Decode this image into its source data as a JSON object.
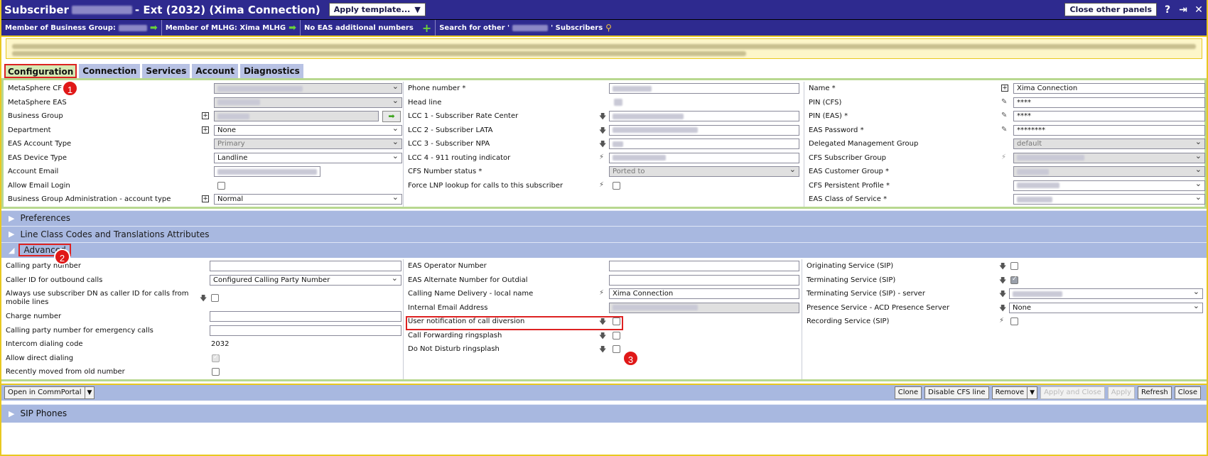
{
  "window": {
    "title_prefix": "Subscriber",
    "title_suffix": "- Ext (2032) (Xima Connection)",
    "apply_template": "Apply template...",
    "close_other_panels": "Close other panels",
    "help": "?",
    "pin": "⇥",
    "close": "✕"
  },
  "infobar": {
    "member_bg": "Member of Business Group:",
    "member_mlhg": "Member of MLHG: Xima MLHG",
    "no_eas": "No EAS additional numbers",
    "search_prefix": "Search for other '",
    "search_suffix": "' Subscribers"
  },
  "tabs": [
    "Configuration",
    "Connection",
    "Services",
    "Account",
    "Diagnostics"
  ],
  "config": {
    "col1": [
      {
        "label": "MetaSphere CFS"
      },
      {
        "label": "MetaSphere EAS"
      },
      {
        "label": "Business Group"
      },
      {
        "label": "Department",
        "value": "None"
      },
      {
        "label": "EAS Account Type",
        "value": "Primary"
      },
      {
        "label": "EAS Device Type",
        "value": "Landline"
      },
      {
        "label": "Account Email"
      },
      {
        "label": "Allow Email Login"
      },
      {
        "label": "Business Group Administration - account type",
        "value": "Normal"
      }
    ],
    "col2": [
      {
        "label": "Phone number *"
      },
      {
        "label": "Head line"
      },
      {
        "label": "LCC 1 - Subscriber Rate Center"
      },
      {
        "label": "LCC 2 - Subscriber LATA"
      },
      {
        "label": "LCC 3 - Subscriber NPA"
      },
      {
        "label": "LCC 4 - 911 routing indicator"
      },
      {
        "label": "CFS Number status *",
        "value": "Ported to"
      },
      {
        "label": "Force LNP lookup for calls to this subscriber"
      }
    ],
    "col3": [
      {
        "label": "Name *",
        "value": "Xima Connection"
      },
      {
        "label": "PIN (CFS)",
        "value": "****"
      },
      {
        "label": "PIN (EAS) *",
        "value": "****"
      },
      {
        "label": "EAS Password *",
        "value": "********"
      },
      {
        "label": "Delegated Management Group",
        "value": "default"
      },
      {
        "label": "CFS Subscriber Group"
      },
      {
        "label": "EAS Customer Group *"
      },
      {
        "label": "CFS Persistent Profile *"
      },
      {
        "label": "EAS Class of Service *"
      }
    ]
  },
  "sections": {
    "preferences": "Preferences",
    "lcc": "Line Class Codes and Translations Attributes",
    "advanced": "Advanced",
    "sip_phones": "SIP Phones"
  },
  "advanced": {
    "col1": [
      {
        "label": "Calling party number"
      },
      {
        "label": "Caller ID for outbound calls",
        "value": "Configured Calling Party Number"
      },
      {
        "label": "Always use subscriber DN as caller ID for calls from mobile lines"
      },
      {
        "label": "Charge number"
      },
      {
        "label": "Calling party number for emergency calls"
      },
      {
        "label": "Intercom dialing code",
        "value": "2032"
      },
      {
        "label": "Allow direct dialing"
      },
      {
        "label": "Recently moved from old number"
      }
    ],
    "col2": [
      {
        "label": "EAS Operator Number"
      },
      {
        "label": "EAS Alternate Number for Outdial"
      },
      {
        "label": "Calling Name Delivery - local name",
        "value": "Xima Connection"
      },
      {
        "label": "Internal Email Address"
      },
      {
        "label": "User notification of call diversion"
      },
      {
        "label": "Call Forwarding ringsplash"
      },
      {
        "label": "Do Not Disturb ringsplash"
      }
    ],
    "col3": [
      {
        "label": "Originating Service (SIP)"
      },
      {
        "label": "Terminating Service (SIP)"
      },
      {
        "label": "Terminating Service (SIP) - server"
      },
      {
        "label": "Presence Service - ACD Presence Server",
        "value": "None"
      },
      {
        "label": "Recording Service (SIP)"
      }
    ]
  },
  "badges": [
    "1",
    "2",
    "3"
  ],
  "footer": {
    "open_commportal": "Open in CommPortal",
    "clone": "Clone",
    "disable_cfs": "Disable CFS line",
    "remove": "Remove",
    "apply_close": "Apply and Close",
    "apply": "Apply",
    "refresh": "Refresh",
    "close": "Close"
  }
}
